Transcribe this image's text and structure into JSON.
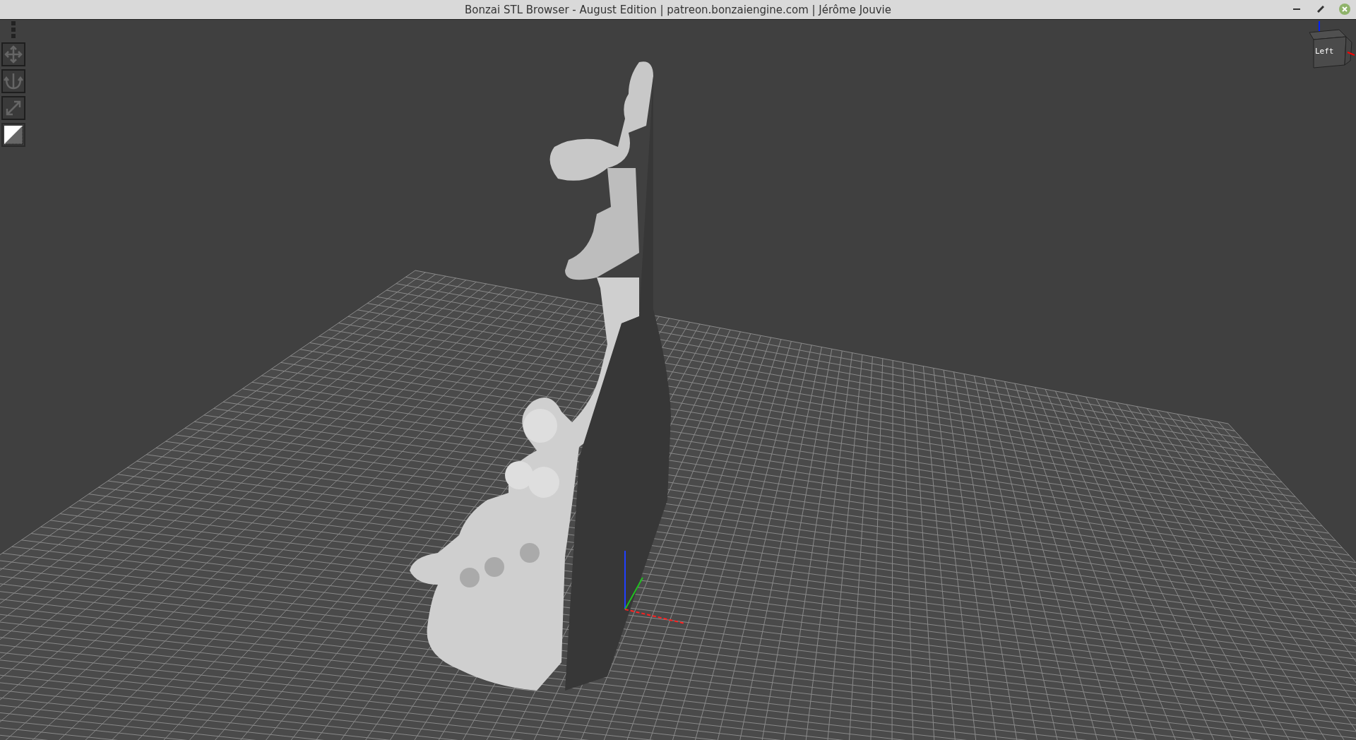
{
  "window": {
    "title": "Bonzai STL Browser - August Edition | patreon.bonzaiengine.com | Jérôme Jouvie"
  },
  "view_cube": {
    "face_label": "Left"
  }
}
